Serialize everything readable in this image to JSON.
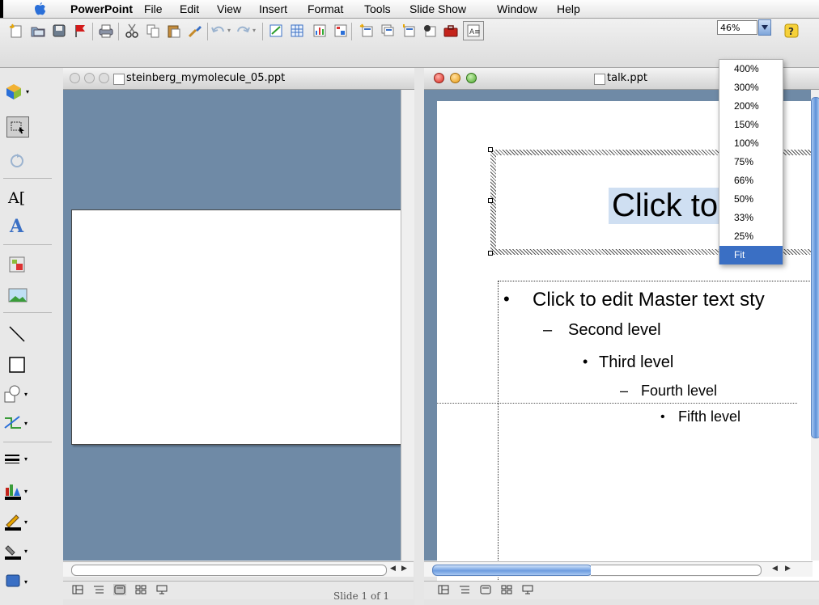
{
  "menubar": {
    "app_name": "PowerPoint",
    "items": [
      "File",
      "Edit",
      "View",
      "Insert",
      "Format",
      "Tools",
      "Slide Show",
      "Window",
      "Help"
    ]
  },
  "toolbar": {
    "icons": [
      "new-slide-icon",
      "open-icon",
      "save-icon",
      "flag-icon",
      "print-icon",
      "cut-icon",
      "copy-icon",
      "paste-icon",
      "format-painter-icon",
      "undo-icon",
      "redo-icon",
      "insert-table-icon",
      "table-grid-icon",
      "chart-icon",
      "org-chart-icon",
      "new-slide-layout-icon",
      "duplicate-slide-icon",
      "slide-layout-icon",
      "slide-master-icon",
      "toolbox-icon",
      "formatting-palette-icon",
      "help-icon"
    ],
    "zoom_value": "46%"
  },
  "zoom_menu": {
    "options": [
      "400%",
      "300%",
      "200%",
      "150%",
      "100%",
      "75%",
      "66%",
      "50%",
      "33%",
      "25%",
      "Fit"
    ],
    "selected": "Fit"
  },
  "palette": {
    "tools": [
      "3d-box-icon",
      "select-icon",
      "rotate-icon",
      "text-box-icon",
      "wordart-icon",
      "clip-art-icon",
      "picture-icon",
      "line-icon",
      "rectangle-icon",
      "autoshapes-icon",
      "connector-icon",
      "line-style-icon",
      "fill-color-icon",
      "line-color-icon",
      "font-color-icon",
      "shadow-icon"
    ]
  },
  "window1": {
    "title": "steinberg_mymolecule_05.ppt",
    "status": "Slide 1 of 1"
  },
  "window2": {
    "title": "talk.ppt",
    "slide": {
      "title_text": "Click to     t M",
      "levels": [
        "Click to edit Master text sty",
        "Second level",
        "Third level",
        "Fourth level",
        "Fifth level"
      ],
      "bullets": [
        "•",
        "–",
        "•",
        "–",
        "•"
      ]
    }
  },
  "colors": {
    "window_bg": "#6f8aa6",
    "selection": "#3a6fc4",
    "title_highlight": "#cfdff2"
  }
}
